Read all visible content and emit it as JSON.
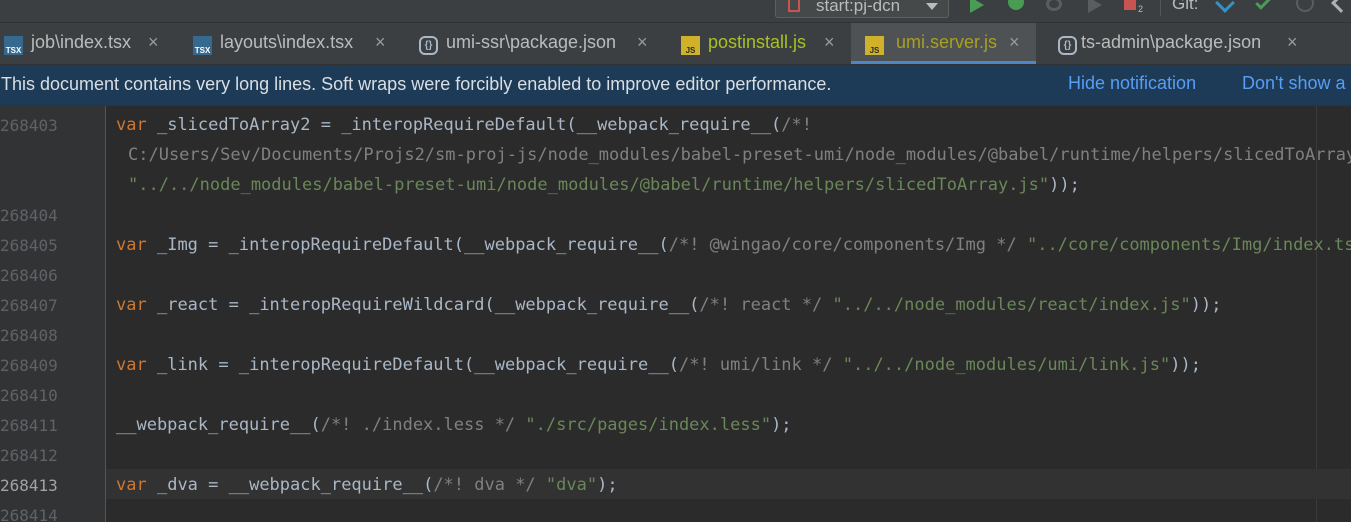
{
  "toolbar": {
    "run_config": "start:pj-dcn",
    "stop_count": "2",
    "git_label": "Git:"
  },
  "tabs": [
    {
      "label": "job\\index.tsx",
      "icon": "TSX",
      "close": "×"
    },
    {
      "label": "layouts\\index.tsx",
      "icon": "TSX",
      "close": "×"
    },
    {
      "label": "umi-ssr\\package.json",
      "icon": "{}",
      "close": "×"
    },
    {
      "label": "postinstall.js",
      "icon": "JS",
      "close": "×"
    },
    {
      "label": "umi.server.js",
      "icon": "JS",
      "close": "×"
    },
    {
      "label": "ts-admin\\package.json",
      "icon": "{}",
      "close": "×"
    }
  ],
  "notification": {
    "message": "This document contains very long lines. Soft wraps were forcibly enabled to improve editor performance.",
    "hide_link": "Hide notification",
    "dont_show_link": "Don't show a"
  },
  "editor": {
    "line_numbers": [
      "268403",
      "",
      "",
      "268404",
      "268405",
      "268406",
      "268407",
      "268408",
      "268409",
      "268410",
      "268411",
      "268412",
      "268413",
      "268414"
    ],
    "code": {
      "l403_kw": "var",
      "l403_mid": "_slicedToArray2 = _interopRequireDefault(__webpack_require__(",
      "l403_cm": "/*!",
      "l403b_cm": "C:/Users/Sev/Documents/Projs2/sm-proj-js/node_modules/babel-preset-umi/node_modules/@babel/runtime/helpers/slicedToArray */",
      "l403c_str": "\"../../node_modules/babel-preset-umi/node_modules/@babel/runtime/helpers/slicedToArray.js\"",
      "l403c_end": "));",
      "l405_kw": "var",
      "l405_mid": "_Img = _interopRequireDefault(__webpack_require__(",
      "l405_cm": "/*! @wingao/core/components/Img */",
      "l405_str": "\"../core/components/Img/index.tsx\")",
      "l407_kw": "var",
      "l407_mid": "_react = _interopRequireWildcard(__webpack_require__(",
      "l407_cm": "/*! react */",
      "l407_str": "\"../../node_modules/react/index.js\"",
      "l407_end": "));",
      "l409_kw": "var",
      "l409_mid": "_link = _interopRequireDefault(__webpack_require__(",
      "l409_cm": "/*! umi/link */",
      "l409_str": "\"../../node_modules/umi/link.js\"",
      "l409_end": "));",
      "l411_mid": "__webpack_require__(",
      "l411_cm": "/*! ./index.less */",
      "l411_str": "\"./src/pages/index.less\"",
      "l411_end": ");",
      "l413_kw": "var",
      "l413_mid": "_dva = __webpack_require__(",
      "l413_cm": "/*! dva */",
      "l413_str": "\"dva\"",
      "l413_end": ");"
    }
  },
  "colors": {
    "keyword": "#cc7832",
    "string": "#6a8759",
    "comment": "#808080",
    "link": "#589df6",
    "notification_bg": "#1d3b57"
  }
}
